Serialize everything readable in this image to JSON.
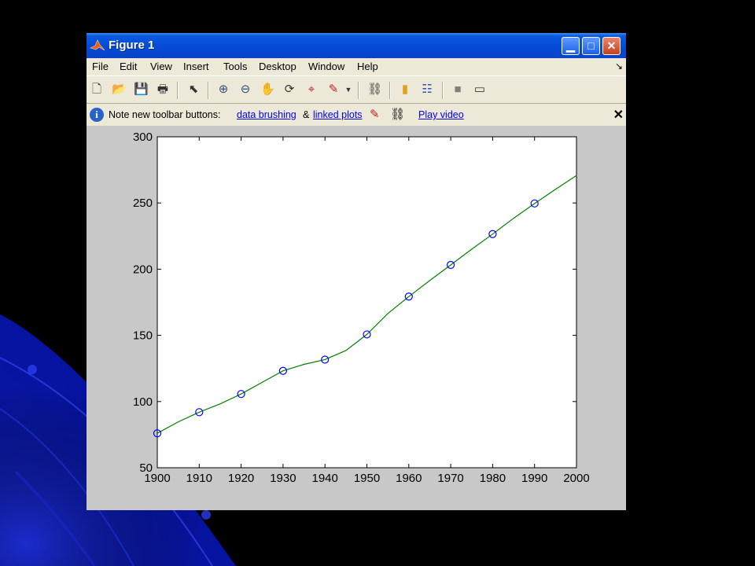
{
  "window": {
    "title": "Figure 1",
    "menu": [
      "File",
      "Edit",
      "View",
      "Insert",
      "Tools",
      "Desktop",
      "Window",
      "Help"
    ],
    "toolbar_icons": [
      "new-figure-icon",
      "open-file-icon",
      "save-icon",
      "print-icon",
      "pointer-icon",
      "zoom-in-icon",
      "zoom-out-icon",
      "pan-icon",
      "rotate-3d-icon",
      "data-cursor-icon",
      "brush-icon",
      "dropdown-arrow-icon",
      "link-plot-icon",
      "colorbar-icon",
      "legend-icon",
      "hide-plot-tools-icon",
      "show-plot-tools-icon"
    ]
  },
  "infobar": {
    "prefix": "Note new toolbar buttons:",
    "link1": "data brushing",
    "amp": "&",
    "link2": "linked plots",
    "link3": "Play video",
    "close": "✕"
  },
  "chart_data": {
    "type": "line",
    "title": "",
    "xlabel": "",
    "ylabel": "",
    "xlim": [
      1900,
      2000
    ],
    "ylim": [
      50,
      300
    ],
    "xticks": [
      1900,
      1910,
      1920,
      1930,
      1940,
      1950,
      1960,
      1970,
      1980,
      1990,
      2000
    ],
    "yticks": [
      50,
      100,
      150,
      200,
      250,
      300
    ],
    "grid": false,
    "legend": false,
    "series": [
      {
        "marker": "o",
        "color": "#0000ff",
        "x": [
          1900,
          1910,
          1920,
          1930,
          1940,
          1950,
          1960,
          1970,
          1980,
          1990
        ],
        "values": [
          75.995,
          91.972,
          105.711,
          123.203,
          131.669,
          150.697,
          179.323,
          203.212,
          226.505,
          249.633
        ]
      },
      {
        "color": "#008000",
        "style": "interpolated",
        "x": [
          1900,
          1905,
          1910,
          1915,
          1920,
          1925,
          1930,
          1935,
          1940,
          1945,
          1950,
          1955,
          1960,
          1965,
          1970,
          1975,
          1980,
          1985,
          1990,
          1995,
          2000
        ],
        "values": [
          76.0,
          84.7,
          92.0,
          98.2,
          105.7,
          114.5,
          123.2,
          128.1,
          131.7,
          138.6,
          150.7,
          166.5,
          179.3,
          191.4,
          203.2,
          215.1,
          226.5,
          238.4,
          249.6,
          260.3,
          270.7
        ]
      }
    ]
  }
}
